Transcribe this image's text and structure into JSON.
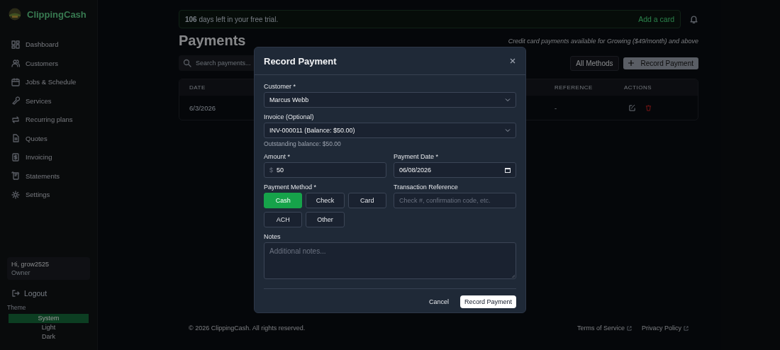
{
  "sidebar": {
    "brand": "ClippingCash",
    "items": [
      {
        "label": "Dashboard",
        "selected": false
      },
      {
        "label": "Customers",
        "selected": false
      },
      {
        "label": "Jobs & Schedule",
        "selected": false
      },
      {
        "label": "Services",
        "selected": false
      },
      {
        "label": "Recurring plans",
        "selected": false
      },
      {
        "label": "Quotes",
        "selected": false
      },
      {
        "label": "Invoicing",
        "selected": false
      },
      {
        "label": "Statements",
        "selected": false
      },
      {
        "label": "Settings",
        "selected": false
      }
    ],
    "user": {
      "greeting": "Hi, grow2525",
      "role": "Owner"
    },
    "logout": "Logout",
    "theme": {
      "label": "Theme",
      "options": [
        {
          "label": "System",
          "selected": true
        },
        {
          "label": "Light",
          "selected": false
        },
        {
          "label": "Dark",
          "selected": false
        }
      ]
    }
  },
  "trial_banner": {
    "text": "**106** days left in your free trial.",
    "action": "Add a card"
  },
  "page": {
    "title": "Payments",
    "note": "Credit card payments available for Growing ($49/month) and above",
    "search": {
      "placeholder": "Search payments..."
    },
    "filter": "All Methods",
    "record_button": "Record Payment"
  },
  "table": {
    "columns": [
      "DATE",
      "REFERENCE",
      "ACTIONS"
    ],
    "rows": [
      {
        "cells": [
          "6/3/2026",
          "-"
        ]
      }
    ]
  },
  "modal": {
    "title": "Record Payment",
    "customer": {
      "label": "Customer *",
      "value": "Marcus Webb"
    },
    "invoice": {
      "label": "Invoice (Optional)",
      "value": "INV-000011 (Balance: $50.00)",
      "hint": "Outstanding balance: $50.00"
    },
    "amount": {
      "label": "Amount *",
      "prefix": "$",
      "value": "50"
    },
    "date": {
      "label": "Payment Date *",
      "value": "06/08/2026"
    },
    "method": {
      "label": "Payment Method *",
      "options": [
        {
          "label": "Cash",
          "selected": true
        },
        {
          "label": "Check",
          "selected": false
        },
        {
          "label": "Card",
          "selected": false
        },
        {
          "label": "ACH",
          "selected": false
        },
        {
          "label": "Other",
          "selected": false
        }
      ]
    },
    "reference": {
      "label": "Transaction Reference",
      "placeholder": "Check #, confirmation code, etc."
    },
    "notes": {
      "label": "Notes",
      "placeholder": "Additional notes..."
    },
    "cancel": "Cancel",
    "submit": "Record Payment"
  },
  "footer": {
    "copyright": "© 2026 ClippingCash. All rights reserved.",
    "links": [
      "Terms of Service",
      "Privacy Policy"
    ]
  }
}
